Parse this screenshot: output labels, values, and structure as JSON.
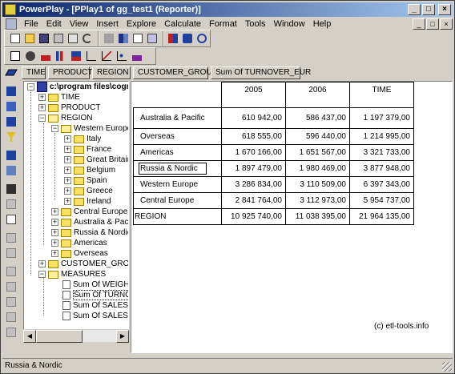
{
  "window": {
    "title": "PowerPlay - [PPlay1 of gg_test1 (Reporter)]",
    "controls": {
      "minimize": "_",
      "maximize": "□",
      "close": "×"
    }
  },
  "menu": [
    "File",
    "Edit",
    "View",
    "Insert",
    "Explore",
    "Calculate",
    "Format",
    "Tools",
    "Window",
    "Help"
  ],
  "toolbar1": [
    "new-icon",
    "open-icon",
    "save-icon",
    "print-icon",
    "print-preview-icon",
    "undo-icon",
    "drill-up-icon",
    "crosstab-icon",
    "indicator-icon",
    "swap-icon",
    "split-icon",
    "zoom-icon",
    "refresh-icon"
  ],
  "toolbar2": [
    "display-icon",
    "pie-icon",
    "simple-bar-icon",
    "clustered-bar-icon",
    "stacked-bar-icon",
    "multiline-icon",
    "line-icon",
    "scatter-icon",
    "3d-bar-icon"
  ],
  "dimension_bar": {
    "tabs": [
      "TIME",
      "PRODUCT",
      "REGION",
      "CUSTOMER_GROUP",
      "Sum Of TURNOVER_EUR"
    ]
  },
  "left_tools": [
    "filter-icon",
    "sort-icon",
    "rank-icon",
    "exception-icon",
    "percent-icon",
    "label-icon",
    "find-icon",
    "hide-icon",
    "suppress-icon",
    "copy-icon",
    "paste-icon",
    "format-icon",
    "sum-icon",
    "calc-icon",
    "pct-icon",
    "stat-icon"
  ],
  "tree": {
    "root": "c:\\program files\\cognos",
    "items": [
      {
        "label": "TIME",
        "level": 1
      },
      {
        "label": "PRODUCT",
        "level": 1
      },
      {
        "label": "REGION",
        "level": 1
      },
      {
        "label": "Western Europe",
        "level": 2
      },
      {
        "label": "Italy",
        "level": 3
      },
      {
        "label": "France",
        "level": 3
      },
      {
        "label": "Great Britain",
        "level": 3
      },
      {
        "label": "Belgium",
        "level": 3
      },
      {
        "label": "Spain",
        "level": 3
      },
      {
        "label": "Greece",
        "level": 3
      },
      {
        "label": "Ireland",
        "level": 3
      },
      {
        "label": "Central Europe",
        "level": 2
      },
      {
        "label": "Australia & Pacific",
        "level": 2
      },
      {
        "label": "Russia & Nordic",
        "level": 2
      },
      {
        "label": "Americas",
        "level": 2
      },
      {
        "label": "Overseas",
        "level": 2
      },
      {
        "label": "CUSTOMER_GROUP",
        "level": 1
      },
      {
        "label": "MEASURES",
        "level": 1
      },
      {
        "label": "Sum Of WEIGHT_KG",
        "level": 2
      },
      {
        "label": "Sum Of TURNOVER_EUR",
        "level": 2
      },
      {
        "label": "Sum Of SALES_COUNT",
        "level": 2
      },
      {
        "label": "Sum Of SALES_DAYS",
        "level": 2
      }
    ]
  },
  "crosstab": {
    "columns": [
      "2005",
      "2006",
      "TIME"
    ],
    "rows": [
      {
        "label": "Australia & Pacific",
        "values": [
          "610 942,00",
          "586 437,00",
          "1 197 379,00"
        ]
      },
      {
        "label": "Overseas",
        "values": [
          "618 555,00",
          "596 440,00",
          "1 214 995,00"
        ]
      },
      {
        "label": "Americas",
        "values": [
          "1 670 166,00",
          "1 651 567,00",
          "3 321 733,00"
        ]
      },
      {
        "label": "Russia & Nordic",
        "values": [
          "1 897 479,00",
          "1 980 469,00",
          "3 877 948,00"
        ]
      },
      {
        "label": "Western Europe",
        "values": [
          "3 286 834,00",
          "3 110 509,00",
          "6 397 343,00"
        ]
      },
      {
        "label": "Central Europe",
        "values": [
          "2 841 764,00",
          "3 112 973,00",
          "5 954 737,00"
        ]
      },
      {
        "label": "REGION",
        "values": [
          "10 925 740,00",
          "11 038 395,00",
          "21 964 135,00"
        ]
      }
    ]
  },
  "copyright": "(c) etl-tools.info",
  "status": "Russia & Nordic",
  "colors": {
    "titlebar_start": "#0a246a",
    "titlebar_end": "#a6caf0",
    "chrome": "#d4d0c8"
  }
}
